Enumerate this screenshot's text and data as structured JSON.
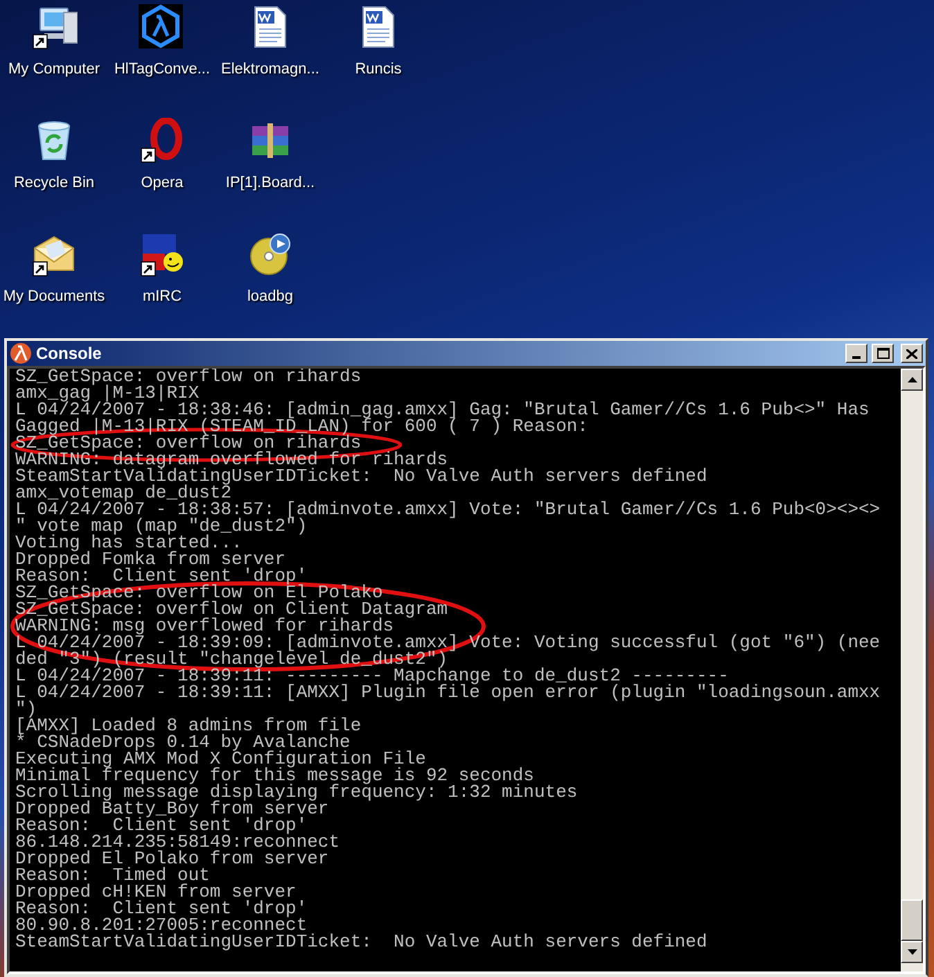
{
  "desktop_icons": [
    {
      "label": "My Computer",
      "kind": "computer",
      "shortcut": true
    },
    {
      "label": "HlTagConve...",
      "kind": "lambda",
      "shortcut": false
    },
    {
      "label": "Elektromagn...",
      "kind": "document",
      "shortcut": false
    },
    {
      "label": "Runcis",
      "kind": "document",
      "shortcut": false
    },
    {
      "label": "Recycle Bin",
      "kind": "recycle",
      "shortcut": false
    },
    {
      "label": "Opera",
      "kind": "opera",
      "shortcut": true
    },
    {
      "label": "IP[1].Board...",
      "kind": "archive",
      "shortcut": false
    },
    {
      "label": "My Documents",
      "kind": "folder",
      "shortcut": true
    },
    {
      "label": "mIRC",
      "kind": "mirc",
      "shortcut": true
    },
    {
      "label": "loadbg",
      "kind": "disc",
      "shortcut": false
    }
  ],
  "console": {
    "title": "Console",
    "lines": [
      "SZ_GetSpace: overflow on rihards",
      "amx_gag |M-13|RIX",
      "L 04/24/2007 - 18:38:46: [admin_gag.amxx] Gag: \"Brutal Gamer//Cs 1.6 Pub<>\" Has",
      "Gagged |M-13|RIX (STEAM_ID_LAN) for 600 ( 7 ) Reason:",
      "SZ_GetSpace: overflow on rihards",
      "WARNING: datagram overflowed for rihards",
      "SteamStartValidatingUserIDTicket:  No Valve Auth servers defined",
      "amx_votemap de_dust2",
      "L 04/24/2007 - 18:38:57: [adminvote.amxx] Vote: \"Brutal Gamer//Cs 1.6 Pub<0><><>",
      "\" vote map (map \"de_dust2\")",
      "Voting has started...",
      "Dropped Fomka from server",
      "Reason:  Client sent 'drop'",
      "SZ_GetSpace: overflow on El Polako",
      "SZ_GetSpace: overflow on Client Datagram",
      "WARNING: msg overflowed for rihards",
      "L 04/24/2007 - 18:39:09: [adminvote.amxx] Vote: Voting successful (got \"6\") (nee",
      "ded \"3\") (result \"changelevel de_dust2\")",
      "L 04/24/2007 - 18:39:11: --------- Mapchange to de_dust2 ---------",
      "L 04/24/2007 - 18:39:11: [AMXX] Plugin file open error (plugin \"loadingsoun.amxx",
      "\")",
      "[AMXX] Loaded 8 admins from file",
      "* CSNadeDrops 0.14 by Avalanche",
      "Executing AMX Mod X Configuration File",
      "Minimal frequency for this message is 92 seconds",
      "Scrolling message displaying frequency: 1:32 minutes",
      "Dropped Batty_Boy from server",
      "Reason:  Client sent 'drop'",
      "86.148.214.235:58149:reconnect",
      "Dropped El Polako from server",
      "Reason:  Timed out",
      "Dropped cH!KEN from server",
      "Reason:  Client sent 'drop'",
      "80.90.8.201:27005:reconnect",
      "SteamStartValidatingUserIDTicket:  No Valve Auth servers defined"
    ]
  }
}
